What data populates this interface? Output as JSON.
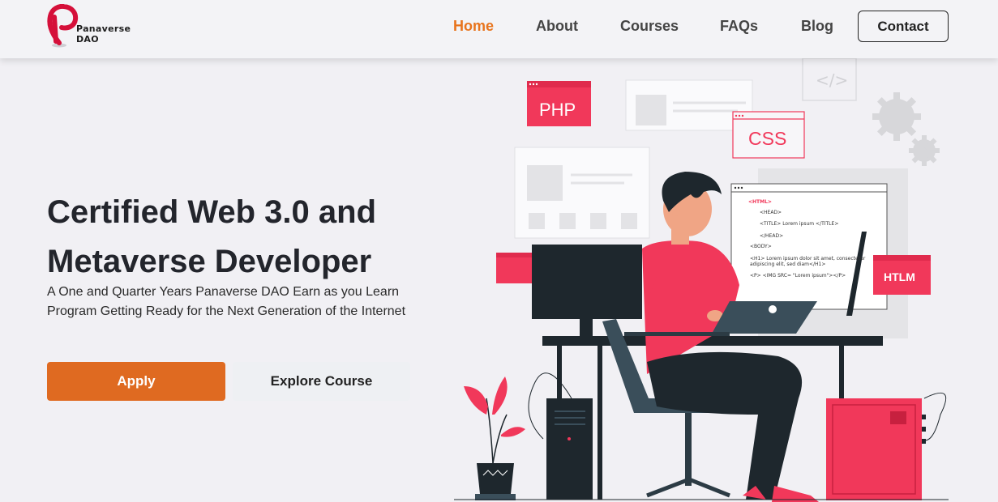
{
  "header": {
    "logo": {
      "line1": "Panaverse",
      "line2": "DAO"
    },
    "nav": [
      {
        "label": "Home",
        "active": true
      },
      {
        "label": "About",
        "active": false
      },
      {
        "label": "Courses",
        "active": false
      },
      {
        "label": "FAQs",
        "active": false
      },
      {
        "label": "Blog",
        "active": false
      }
    ],
    "contact_label": "Contact"
  },
  "hero": {
    "title_line1": "Certified Web 3.0 and",
    "title_line2": "Metaverse Developer",
    "subtitle_line1": "A One and Quarter Years Panaverse DAO Earn as you Learn",
    "subtitle_line2": "Program Getting Ready for the Next Generation of the Internet",
    "apply_label": "Apply",
    "explore_label": "Explore Course"
  },
  "illustration": {
    "badges": {
      "php": "PHP",
      "css": "CSS",
      "htlm": "HTLM"
    },
    "code_lines": [
      "<HTML>",
      "<HEAD>",
      "<TITLE> Lorem ipsum </TITLE>",
      "</HEAD>",
      "<BODY>",
      "<H1> Lorem ipsum dolor sit amet, consectetur",
      "adipiscing elit, sed diam</H1>",
      "<P> <IMG SRC= \"Lorem ipsum\"></P>"
    ]
  },
  "colors": {
    "accent": "#df6a21",
    "nav_active": "#e8741d",
    "brand_red": "#f1385a",
    "dark": "#23252c"
  }
}
